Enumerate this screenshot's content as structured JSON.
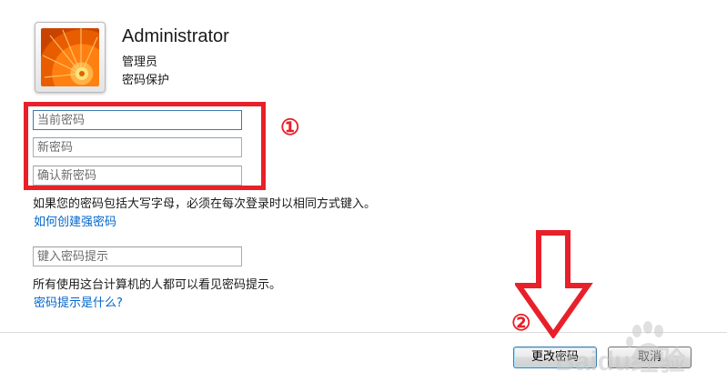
{
  "user": {
    "name": "Administrator",
    "role": "管理员",
    "status": "密码保护"
  },
  "fields": {
    "current_password_placeholder": "当前密码",
    "new_password_placeholder": "新密码",
    "confirm_password_placeholder": "确认新密码",
    "hint_placeholder": "键入密码提示"
  },
  "texts": {
    "case_warning": "如果您的密码包括大写字母，必须在每次登录时以相同方式键入。",
    "strong_password_link": "如何创建强密码",
    "hint_warning": "所有使用这台计算机的人都可以看见密码提示。",
    "hint_link": "密码提示是什么?"
  },
  "annotations": {
    "marker_1": "①",
    "marker_2": "②",
    "accent_color": "#e8202a"
  },
  "buttons": {
    "change_password": "更改密码",
    "cancel": "取消"
  },
  "watermark": {
    "text": "Baidu经验",
    "icon": "baidu-paw-icon"
  }
}
